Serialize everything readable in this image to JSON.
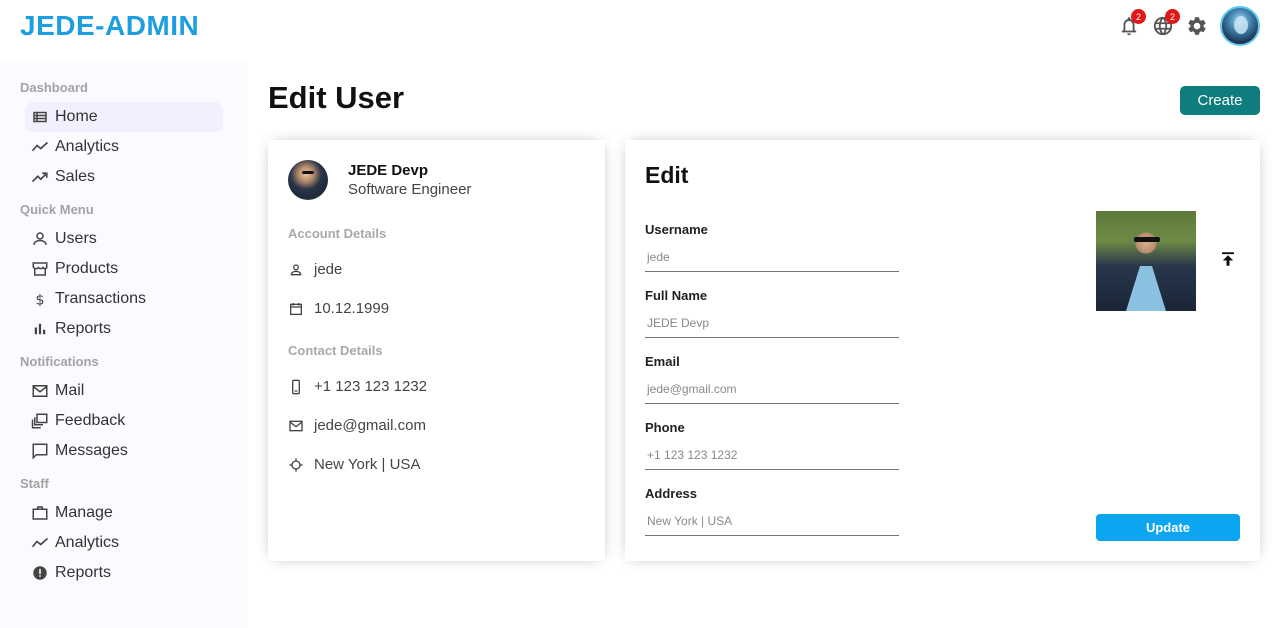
{
  "app": {
    "logo": "JEDE-ADMIN"
  },
  "topbar": {
    "notifications_badge": "2",
    "language_badge": "2"
  },
  "sidebar": {
    "sections": [
      {
        "title": "Dashboard",
        "items": [
          {
            "label": "Home",
            "icon": "home-table-icon"
          },
          {
            "label": "Analytics",
            "icon": "timeline-icon"
          },
          {
            "label": "Sales",
            "icon": "trending-up-icon"
          }
        ]
      },
      {
        "title": "Quick Menu",
        "items": [
          {
            "label": "Users",
            "icon": "person-icon"
          },
          {
            "label": "Products",
            "icon": "storefront-icon"
          },
          {
            "label": "Transactions",
            "icon": "dollar-icon"
          },
          {
            "label": "Reports",
            "icon": "bar-chart-icon"
          }
        ]
      },
      {
        "title": "Notifications",
        "items": [
          {
            "label": "Mail",
            "icon": "mail-icon"
          },
          {
            "label": "Feedback",
            "icon": "feedback-icon"
          },
          {
            "label": "Messages",
            "icon": "chat-icon"
          }
        ]
      },
      {
        "title": "Staff",
        "items": [
          {
            "label": "Manage",
            "icon": "briefcase-icon"
          },
          {
            "label": "Analytics",
            "icon": "timeline-icon"
          },
          {
            "label": "Reports",
            "icon": "report-icon"
          }
        ]
      }
    ]
  },
  "main": {
    "title": "Edit User",
    "create_label": "Create"
  },
  "show": {
    "name": "JEDE Devp",
    "job": "Software Engineer",
    "account_title": "Account Details",
    "username": "jede",
    "birthday": "10.12.1999",
    "contact_title": "Contact Details",
    "phone": "+1 123 123 1232",
    "email": "jede@gmail.com",
    "address": "New York | USA"
  },
  "edit": {
    "title": "Edit",
    "fields": [
      {
        "label": "Username",
        "placeholder": "jede"
      },
      {
        "label": "Full Name",
        "placeholder": "JEDE Devp"
      },
      {
        "label": "Email",
        "placeholder": "jede@gmail.com"
      },
      {
        "label": "Phone",
        "placeholder": "+1 123 123 1232"
      },
      {
        "label": "Address",
        "placeholder": "New York | USA"
      }
    ],
    "update_label": "Update"
  },
  "colors": {
    "logo": "#1e9ee0",
    "create_button": "#0f7d7d",
    "update_button": "#0ca5f0",
    "badge": "#e01818",
    "sidebar_bg": "#fbfbff",
    "active_item_bg": "#f0f0ff"
  }
}
